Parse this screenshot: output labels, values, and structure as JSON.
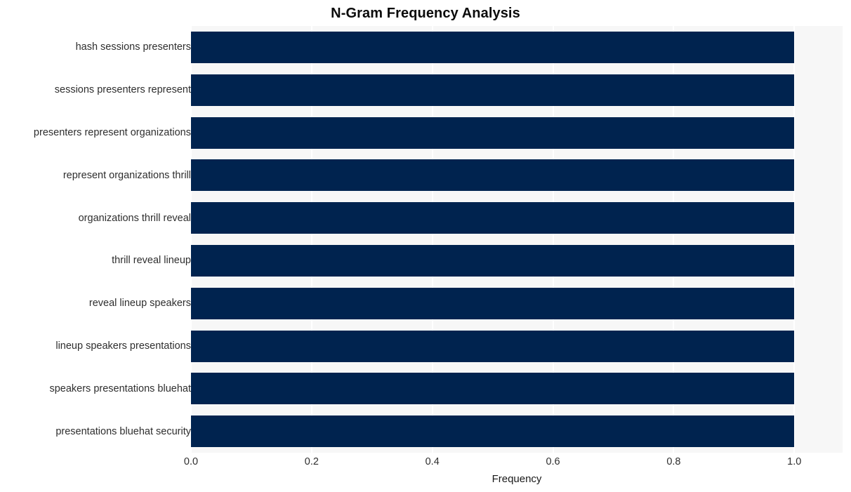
{
  "chart_data": {
    "type": "bar",
    "orientation": "horizontal",
    "title": "N-Gram Frequency Analysis",
    "xlabel": "Frequency",
    "ylabel": "",
    "categories": [
      "hash sessions presenters",
      "sessions presenters represent",
      "presenters represent organizations",
      "represent organizations thrill",
      "organizations thrill reveal",
      "thrill reveal lineup",
      "reveal lineup speakers",
      "lineup speakers presentations",
      "speakers presentations bluehat",
      "presentations bluehat security"
    ],
    "values": [
      1.0,
      1.0,
      1.0,
      1.0,
      1.0,
      1.0,
      1.0,
      1.0,
      1.0,
      1.0
    ],
    "xlim": [
      0.0,
      1.08
    ],
    "xticks": [
      0.0,
      0.2,
      0.4,
      0.6,
      0.8,
      1.0
    ],
    "xticklabels": [
      "0.0",
      "0.2",
      "0.4",
      "0.6",
      "0.8",
      "1.0"
    ],
    "grid": true,
    "grid_axis": "x",
    "legend": null,
    "bar_color": "#00234f",
    "plot_background": "#f7f7f7",
    "figure_background": "#ffffff",
    "gridline_color": "#ffffff"
  }
}
